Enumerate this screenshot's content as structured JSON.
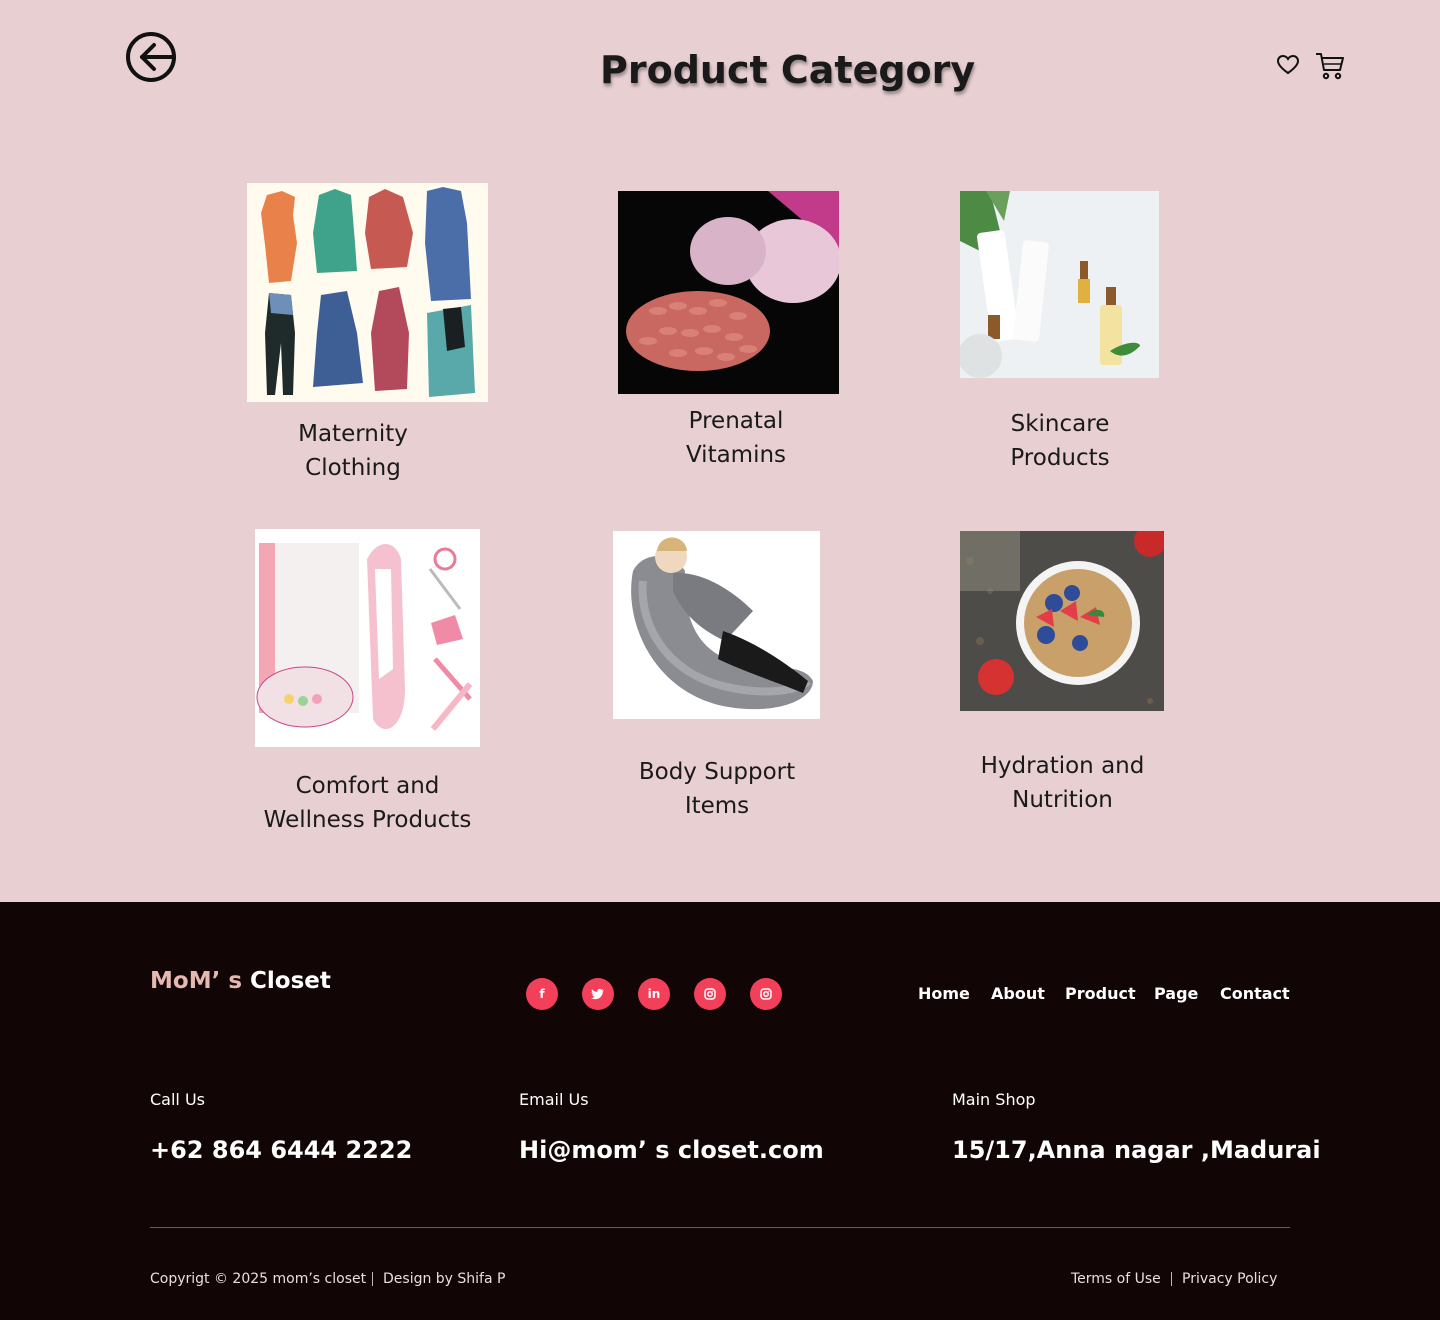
{
  "header": {
    "title": "Product Category",
    "icons": [
      "back-arrow-icon",
      "heart-icon",
      "cart-icon"
    ]
  },
  "categories": [
    {
      "label": "Maternity\nClothing",
      "image": "maternity-clothing-image"
    },
    {
      "label": "Prenatal\nVitamins",
      "image": "prenatal-vitamins-image"
    },
    {
      "label": "Skincare\nProducts",
      "image": "skincare-products-image"
    },
    {
      "label": "Comfort and\nWellness Products",
      "image": "baby-manicure-kit-image"
    },
    {
      "label": "Body Support\nItems",
      "image": "pregnancy-pillow-image"
    },
    {
      "label": "Hydration and\nNutrition",
      "image": "fruit-granola-bowl-image"
    }
  ],
  "footer": {
    "brand_part1": "MoM’ s",
    "brand_part2": "Closet",
    "social": [
      {
        "name": "facebook-icon",
        "glyph": "f"
      },
      {
        "name": "twitter-icon",
        "glyph": "🐦"
      },
      {
        "name": "linkedin-icon",
        "glyph": "in"
      },
      {
        "name": "instagram-icon",
        "glyph": "◎"
      },
      {
        "name": "instagram-icon-2",
        "glyph": "◎"
      }
    ],
    "nav": [
      "Home",
      "About",
      "Product",
      "Page",
      "Contact"
    ],
    "call_label": "Call Us",
    "call_value": "+62 864 6444 2222",
    "email_label": "Email Us",
    "email_value": "Hi@mom’ s  closet.com",
    "shop_label": "Main Shop",
    "shop_value": "15/17,Anna nagar ,Madurai",
    "copyright": "Copyrigt © 2025 mom’s closet",
    "design": "Design by Shifa P",
    "terms": "Terms of Use",
    "privacy": "Privacy Policy"
  },
  "colors": {
    "page_bg": "#e8cfd2",
    "footer_bg": "#120506",
    "brand_accent": "#e6b9b0",
    "social_bg": "#f2405a"
  }
}
